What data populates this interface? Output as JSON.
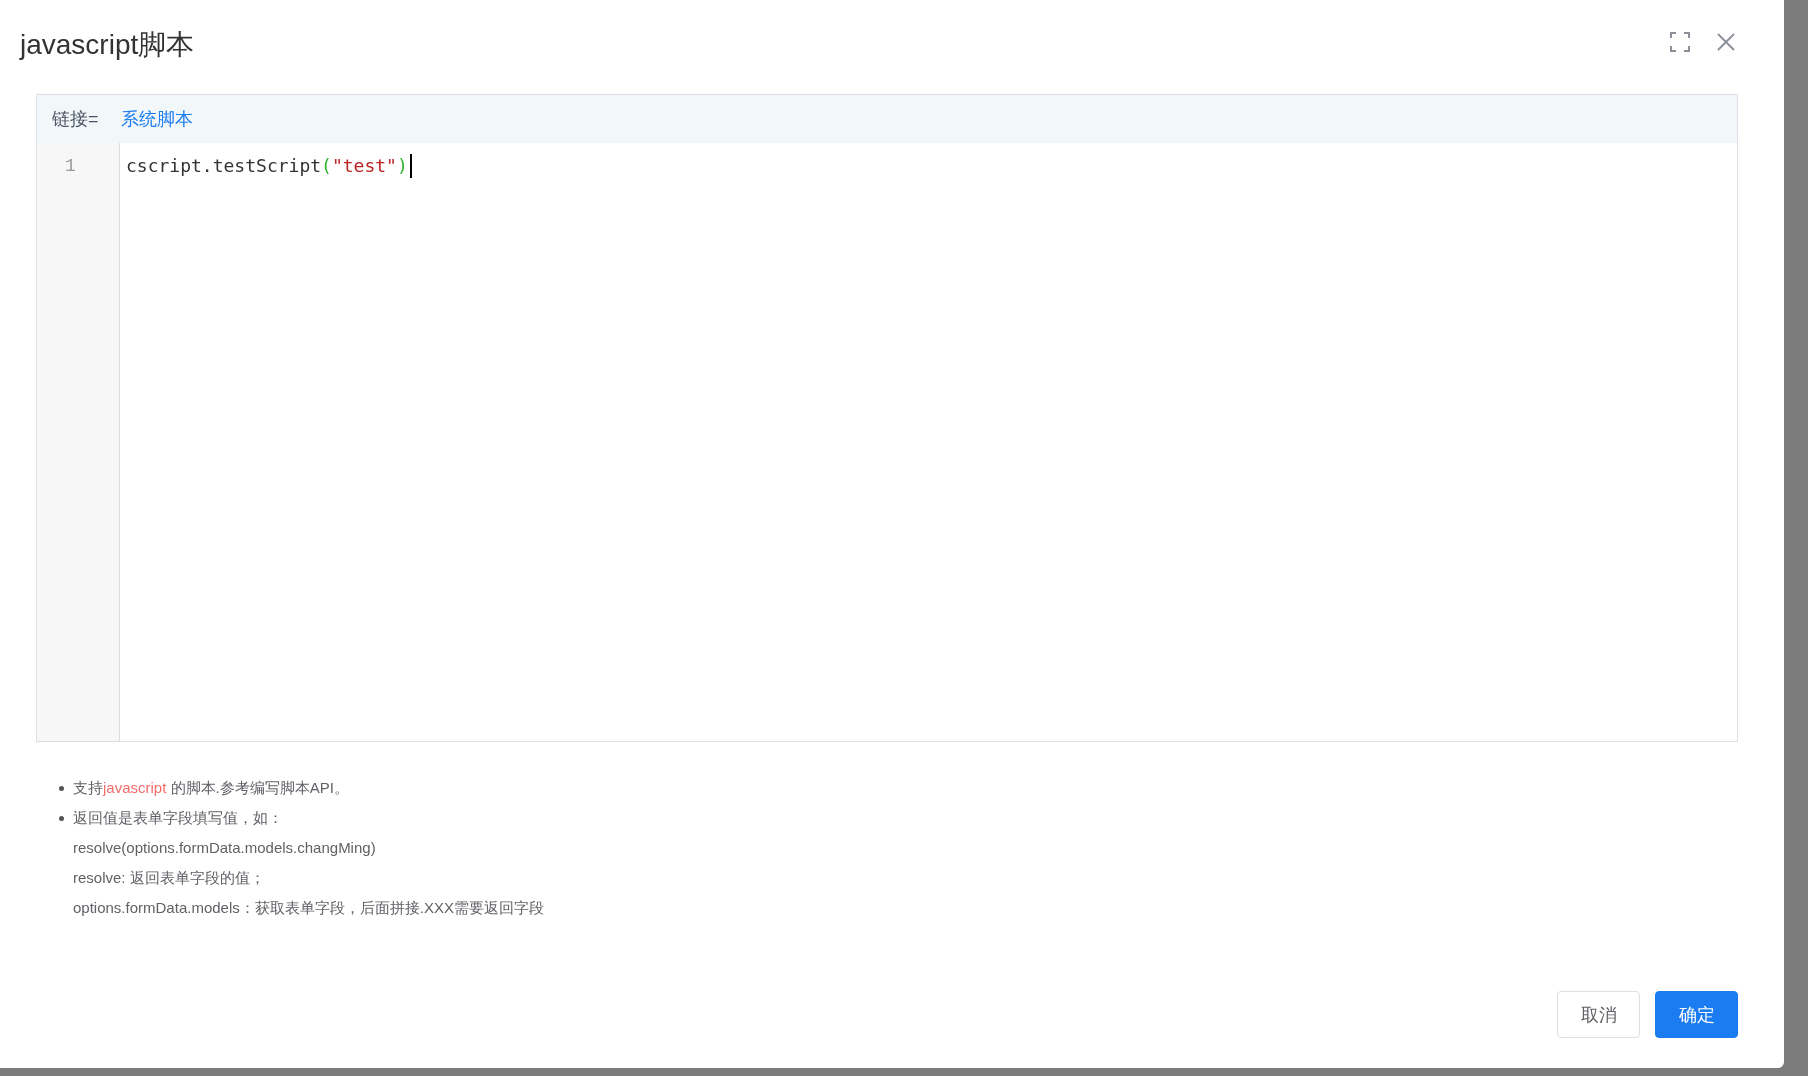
{
  "dialog": {
    "title": "javascript脚本"
  },
  "editor": {
    "header_label": "链接=",
    "header_link": "系统脚本",
    "lines": [
      {
        "number": "1",
        "tokens": [
          {
            "kind": "plain",
            "text": "cscript.testScript"
          },
          {
            "kind": "bracket",
            "text": "("
          },
          {
            "kind": "string",
            "text": "\"test\""
          },
          {
            "kind": "bracket",
            "text": ")"
          }
        ]
      }
    ]
  },
  "notes": [
    {
      "bullet": true,
      "parts": [
        {
          "kind": "plain",
          "text": "支持"
        },
        {
          "kind": "highlight",
          "text": "javascript"
        },
        {
          "kind": "plain",
          "text": " 的脚本.参考编写脚本API。"
        }
      ]
    },
    {
      "bullet": true,
      "parts": [
        {
          "kind": "plain",
          "text": "返回值是表单字段填写值，如："
        }
      ]
    },
    {
      "bullet": false,
      "parts": [
        {
          "kind": "plain",
          "text": "resolve(options.formData.models.changMing)"
        }
      ]
    },
    {
      "bullet": false,
      "parts": [
        {
          "kind": "plain",
          "text": "resolve: 返回表单字段的值；"
        }
      ]
    },
    {
      "bullet": false,
      "parts": [
        {
          "kind": "plain",
          "text": "options.formData.models：获取表单字段，后面拼接.XXX需要返回字段"
        }
      ]
    }
  ],
  "buttons": [
    {
      "kind": "default",
      "label": "取消"
    },
    {
      "kind": "primary",
      "label": "确定"
    }
  ]
}
